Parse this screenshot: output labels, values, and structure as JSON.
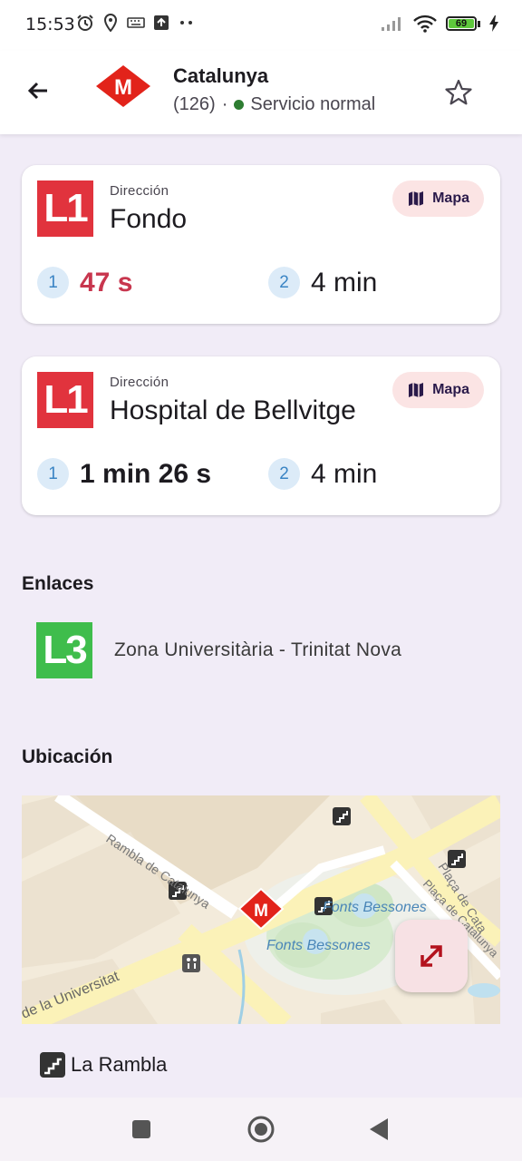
{
  "status_bar": {
    "time": "15:53",
    "battery": "69",
    "icons_left": [
      "alarm-icon",
      "location-icon",
      "keyboard-icon",
      "upload-icon",
      "more-icon"
    ],
    "icons_right": [
      "signal-icon",
      "wifi-icon",
      "battery-icon",
      "charging-icon"
    ]
  },
  "header": {
    "station_name": "Catalunya",
    "station_code": "(126)",
    "separator": "·",
    "service_status": "Servicio normal",
    "status_color": "#2e7d32",
    "metro_logo_color": "#e2231a"
  },
  "departures": [
    {
      "line": "L1",
      "line_color": "#e1333d",
      "direction_label": "Dirección",
      "direction": "Fondo",
      "map_label": "Mapa",
      "trains": [
        {
          "num": "1",
          "time": "47 s"
        },
        {
          "num": "2",
          "time": "4 min"
        }
      ]
    },
    {
      "line": "L1",
      "line_color": "#e1333d",
      "direction_label": "Dirección",
      "direction": "Hospital de Bellvitge",
      "map_label": "Mapa",
      "trains": [
        {
          "num": "1",
          "time": "1 min 26 s"
        },
        {
          "num": "2",
          "time": "4 min"
        }
      ]
    }
  ],
  "links": {
    "title": "Enlaces",
    "items": [
      {
        "line": "L3",
        "line_color": "#3fbd4c",
        "name": "Zona Universitària - Trinitat Nova"
      }
    ]
  },
  "location": {
    "title": "Ubicación",
    "map_labels": {
      "rambla_catalunya": "Rambla de Catalunya",
      "placa_catalunya_1": "Plaça de Cata",
      "placa_catalunya_2": "Plaça de Catalunya",
      "fonts_bessones_1": "Fonts Bessones",
      "fonts_bessones_2": "Fonts Bessones",
      "universitat": "de la Universitat"
    },
    "exit_name": "La Rambla"
  }
}
